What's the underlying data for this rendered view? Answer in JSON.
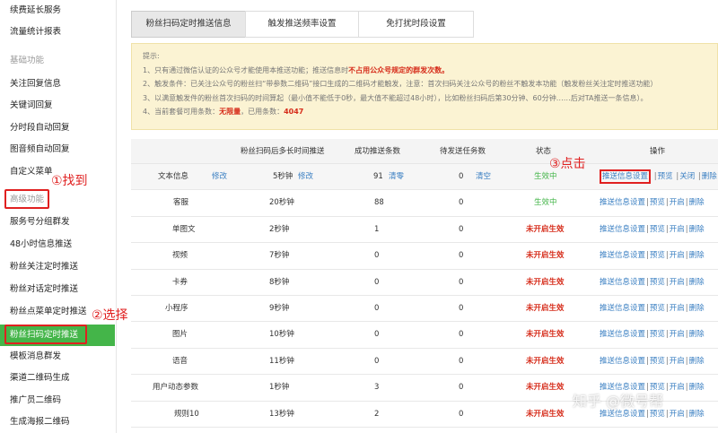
{
  "sidebar": {
    "items": [
      {
        "label": "续费延长服务",
        "section": false,
        "active": false
      },
      {
        "label": "流量统计报表",
        "section": false,
        "active": false
      },
      {
        "label": "基础功能",
        "section": true,
        "active": false
      },
      {
        "label": "关注回复信息",
        "section": false,
        "active": false
      },
      {
        "label": "关键词回复",
        "section": false,
        "active": false
      },
      {
        "label": "分时段自动回复",
        "section": false,
        "active": false
      },
      {
        "label": "图音频自动回复",
        "section": false,
        "active": false
      },
      {
        "label": "自定义菜单",
        "section": false,
        "active": false
      },
      {
        "label": "高级功能",
        "section": true,
        "active": false
      },
      {
        "label": "服务号分组群发",
        "section": false,
        "active": false
      },
      {
        "label": "48小时信息推送",
        "section": false,
        "active": false
      },
      {
        "label": "粉丝关注定时推送",
        "section": false,
        "active": false
      },
      {
        "label": "粉丝对话定时推送",
        "section": false,
        "active": false
      },
      {
        "label": "粉丝点菜单定时推送",
        "section": false,
        "active": false
      },
      {
        "label": "粉丝扫码定时推送",
        "section": false,
        "active": true
      },
      {
        "label": "模板消息群发",
        "section": false,
        "active": false
      },
      {
        "label": "渠道二维码生成",
        "section": false,
        "active": false
      },
      {
        "label": "推广员二维码",
        "section": false,
        "active": false
      },
      {
        "label": "生成海报二维码",
        "section": false,
        "active": false
      }
    ]
  },
  "annotations": {
    "find": "①找到",
    "select": "②选择",
    "click": "③点击"
  },
  "tabs": [
    {
      "label": "粉丝扫码定时推送信息",
      "active": true
    },
    {
      "label": "触发推送频率设置",
      "active": false
    },
    {
      "label": "免打扰时段设置",
      "active": false
    }
  ],
  "notice": {
    "title": "提示:",
    "line1_a": "1、只有通过微信认证的公众号才能使用本推送功能；推送信息时",
    "line1_b": "不占用公众号规定的群发次数。",
    "line2": "2、触发条件：已关注公众号的粉丝扫“带参数二维码”接口生成的二维码才能触发，注意：首次扫码关注公众号的粉丝不触发本功能（触发粉丝关注定时推送功能）",
    "line3": "3、以满意触发件的粉丝首次扫码的时间算起（最小值不能低于0秒，最大值不能超过48小时），比如粉丝扫码后第30分钟、60分钟……后对TA推送一条信息）。",
    "line4_a": "4、当前套餐可用条数：",
    "line4_b": "无限量",
    "line4_c": "，已用条数：",
    "line4_d": "4047"
  },
  "table": {
    "headers": {
      "delay": "粉丝扫码后多长时间推送",
      "success": "成功推送条数",
      "pending": "待发送任务数",
      "status": "状态",
      "ops": "操作"
    },
    "ops": {
      "settings": "推送信息设置",
      "preview": "预览",
      "close": "关闭",
      "open": "开启",
      "delete": "删除",
      "sep": "|"
    },
    "first_row": {
      "type": "文本信息",
      "edit1": "修改",
      "delay": "5秒钟",
      "edit2": "修改",
      "success": "91",
      "clear1": "清零",
      "pending": "0",
      "clear2": "清空",
      "status": "生效中"
    },
    "rows": [
      {
        "type": "客服",
        "delay": "20秒钟",
        "success": "88",
        "pending": "0",
        "status": "生效中",
        "on": true
      },
      {
        "type": "单图文",
        "delay": "2秒钟",
        "success": "1",
        "pending": "0",
        "status": "未开启生效",
        "on": false
      },
      {
        "type": "视频",
        "delay": "7秒钟",
        "success": "0",
        "pending": "0",
        "status": "未开启生效",
        "on": false
      },
      {
        "type": "卡券",
        "delay": "8秒钟",
        "success": "0",
        "pending": "0",
        "status": "未开启生效",
        "on": false
      },
      {
        "type": "小程序",
        "delay": "9秒钟",
        "success": "0",
        "pending": "0",
        "status": "未开启生效",
        "on": false
      },
      {
        "type": "图片",
        "delay": "10秒钟",
        "success": "0",
        "pending": "0",
        "status": "未开启生效",
        "on": false
      },
      {
        "type": "语音",
        "delay": "11秒钟",
        "success": "0",
        "pending": "0",
        "status": "未开启生效",
        "on": false
      },
      {
        "type": "用户动态参数",
        "delay": "1秒钟",
        "success": "3",
        "pending": "0",
        "status": "未开启生效",
        "on": false
      },
      {
        "type": "规则10",
        "delay": "13秒钟",
        "success": "2",
        "pending": "0",
        "status": "未开启生效",
        "on": false
      }
    ]
  },
  "watermark": "知乎 @微号帮",
  "colors": {
    "accent_green": "#44b549",
    "annotation_red": "#e02020",
    "link_blue": "#3a7fc2"
  }
}
